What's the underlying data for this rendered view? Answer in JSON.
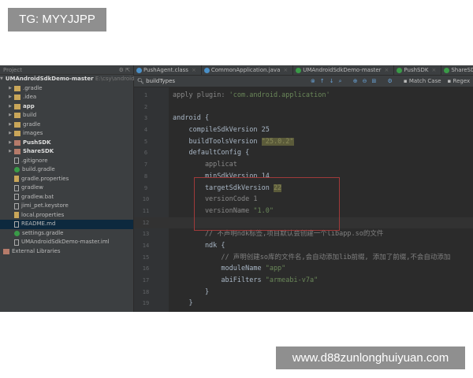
{
  "overlay": {
    "tag": "TG: MYYJJPP",
    "watermark": "www.d88zunlonghuiyuan.com"
  },
  "sidebar": {
    "title": "Project",
    "root": "UMAndroidSdkDemo-master",
    "root_path": "E:\\csy\\android_s",
    "items": [
      {
        "label": ".gradle",
        "type": "folder",
        "expand": true,
        "bold": false
      },
      {
        "label": ".idea",
        "type": "folder",
        "expand": true,
        "bold": false
      },
      {
        "label": "app",
        "type": "folder",
        "expand": true,
        "bold": true
      },
      {
        "label": "build",
        "type": "folder",
        "expand": true,
        "bold": false
      },
      {
        "label": "gradle",
        "type": "folder",
        "expand": true,
        "bold": false
      },
      {
        "label": "images",
        "type": "folder",
        "expand": true,
        "bold": false
      },
      {
        "label": "PushSDK",
        "type": "lib",
        "expand": true,
        "bold": true
      },
      {
        "label": "ShareSDK",
        "type": "lib",
        "expand": true,
        "bold": true
      },
      {
        "label": ".gitignore",
        "type": "file"
      },
      {
        "label": "build.gradle",
        "type": "gradle"
      },
      {
        "label": "gradle.properties",
        "type": "prop"
      },
      {
        "label": "gradlew",
        "type": "file"
      },
      {
        "label": "gradlew.bat",
        "type": "file"
      },
      {
        "label": "jimi_pet.keystore",
        "type": "file"
      },
      {
        "label": "local.properties",
        "type": "prop"
      },
      {
        "label": "README.md",
        "type": "file",
        "selected": true
      },
      {
        "label": "settings.gradle",
        "type": "gradle"
      },
      {
        "label": "UMAndroidSdkDemo-master.iml",
        "type": "file"
      }
    ],
    "external": "External Libraries"
  },
  "tabs": [
    {
      "label": "PushAgent.class",
      "color": "#4a90c8"
    },
    {
      "label": "CommonApplication.java",
      "color": "#4a90c8"
    },
    {
      "label": "UMAndroidSdkDemo-master",
      "color": "#3a9b48"
    },
    {
      "label": "PushSDK",
      "color": "#3a9b48"
    },
    {
      "label": "ShareSDK",
      "color": "#3a9b48"
    }
  ],
  "search": {
    "query": "buildTypes",
    "match_case": "Match Case",
    "regex": "Regex"
  },
  "code": [
    "apply plugin: 'com.android.application'",
    "",
    "android {",
    "    compileSdkVersion 25",
    "    buildToolsVersion \"25.0.2\"",
    "    defaultConfig {",
    "        applicat",
    "        minSdkVersion 14",
    "        targetSdkVersion 22",
    "        versionCode 1",
    "        versionName \"1.0\"",
    "",
    "        // 不声明ndk标签,项目默认会创建一个libapp.so的文件",
    "        ndk {",
    "            // 声明创建so库的文件名,会自动添加lib前缀, 添加了前缀,不会自动添加",
    "            moduleName \"app\"",
    "            abiFilters \"armeabi-v7a\"",
    "        }",
    "    }"
  ],
  "colors": {
    "editor_bg": "#2b2b2b",
    "sidebar_bg": "#3c3f41",
    "highlight_box": "#a03a3a"
  }
}
